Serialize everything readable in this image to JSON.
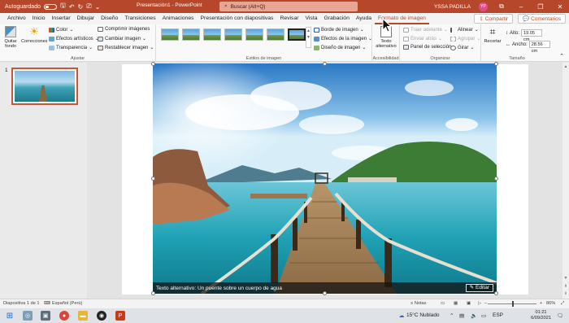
{
  "titlebar": {
    "autosave_label": "Autoguardado",
    "window_title": "Presentación1  -  PowerPoint",
    "search_placeholder": "Buscar (Alt+Q)",
    "user_name": "YSSA PADILLA",
    "user_initials": "YP"
  },
  "tabs": [
    "Archivo",
    "Inicio",
    "Insertar",
    "Dibujar",
    "Diseño",
    "Transiciones",
    "Animaciones",
    "Presentación con diapositivas",
    "Revisar",
    "Vista",
    "Grabación",
    "Ayuda",
    "Formato de imagen"
  ],
  "active_tab": "Formato de imagen",
  "share_label": "Compartir",
  "comments_label": "Comentarios",
  "ribbon": {
    "ajustar": {
      "label": "Ajustar",
      "quitar_fondo": "Quitar fondo",
      "correcciones": "Correcciones",
      "color": "Color",
      "efectos": "Efectos artísticos",
      "transparencia": "Transparencia",
      "comprimir": "Comprimir imágenes",
      "cambiar": "Cambiar imagen",
      "restablecer": "Restablecer imagen"
    },
    "estilos": {
      "label": "Estilos de imagen",
      "borde": "Borde de imagen",
      "efectos": "Efectos de la imagen",
      "diseno": "Diseño de imagen"
    },
    "accesibilidad": {
      "label": "Accesibilidad",
      "texto_alt": "Texto alternativo"
    },
    "organizar": {
      "label": "Organizar",
      "traer": "Traer adelante",
      "enviar": "Enviar atrás",
      "panel": "Panel de selección",
      "alinear": "Alinear",
      "agrupar": "Agrupar",
      "girar": "Girar"
    },
    "tamano": {
      "label": "Tamaño",
      "recortar": "Recortar",
      "alto_label": "Alto:",
      "alto_value": "19.05 cm",
      "ancho_label": "Ancho:",
      "ancho_value": "28.56 cm"
    }
  },
  "slides": {
    "current_number": "1"
  },
  "picture": {
    "alt_text": "Texto alternativo: Un puente sobre un cuerpo de agua",
    "edit_label": "Editar"
  },
  "statusbar": {
    "slide_info": "Diapositiva 1 de 1",
    "language": "Español (Perú)",
    "notes": "Notas",
    "zoom": "86%"
  },
  "taskbar": {
    "weather": "15°C  Nublado",
    "lang": "ESP",
    "time": "01:21",
    "date": "6/09/2021"
  },
  "colors": {
    "accent": "#b7472a",
    "titlebar": "#b7472a"
  }
}
